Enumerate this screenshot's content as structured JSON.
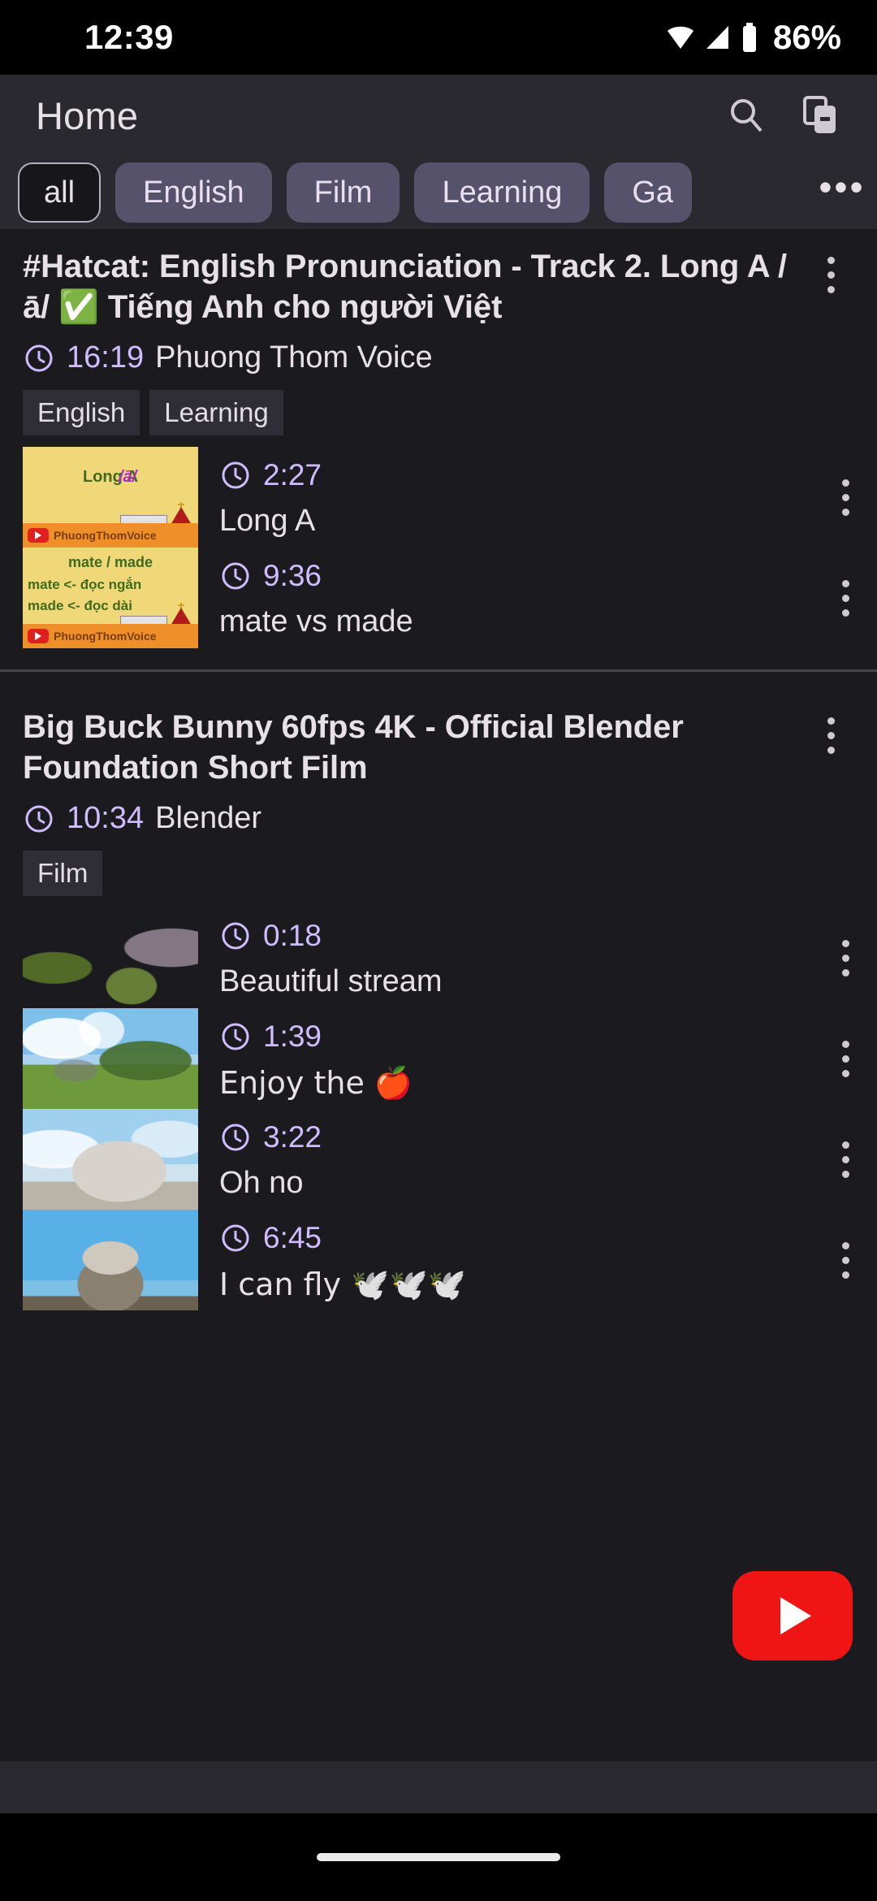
{
  "status_bar": {
    "time": "12:39",
    "battery_percent": "86%",
    "icons": [
      "wifi-icon",
      "signal-icon",
      "battery-icon"
    ]
  },
  "app_bar": {
    "title": "Home",
    "actions": [
      {
        "name": "search-icon",
        "label": "Search"
      },
      {
        "name": "queue-icon",
        "label": "Queue"
      }
    ]
  },
  "filter_chips": {
    "items": [
      {
        "label": "all",
        "selected": true
      },
      {
        "label": "English",
        "selected": false
      },
      {
        "label": "Film",
        "selected": false
      },
      {
        "label": "Learning",
        "selected": false
      },
      {
        "label": "Ga",
        "selected": false
      }
    ],
    "overflow_label": "•••"
  },
  "videos": [
    {
      "title": "#Hatcat: English Pronunciation - Track 2. Long A /ā/ ✅ Tiếng Anh cho người Việt",
      "duration": "16:19",
      "channel": "Phuong Thom Voice",
      "tags": [
        "English",
        "Learning"
      ],
      "thumb_kind": "yellow",
      "items": [
        {
          "time": "2:27",
          "label": "Long A",
          "thumb": "long-a",
          "thumb_line1": "Long A",
          "thumb_line2": "/ā/",
          "watermark": "PhuongThomVoice"
        },
        {
          "time": "9:36",
          "label": "mate vs made",
          "thumb": "mate-made",
          "thumb_line1": "mate / made",
          "thumb_line2": "mate <- đọc ngắn",
          "thumb_line3": "made <- đọc dài",
          "watermark": "PhuongThomVoice"
        }
      ]
    },
    {
      "title": "Big Buck Bunny 60fps 4K - Official Blender Foundation Short Film",
      "duration": "10:34",
      "channel": "Blender",
      "tags": [
        "Film"
      ],
      "thumb_kind": "photo",
      "items": [
        {
          "time": "0:18",
          "label": "Beautiful stream",
          "thumb": "grass-stream"
        },
        {
          "time": "1:39",
          "label": "Enjoy the 🍎",
          "thumb": "sky-meadow"
        },
        {
          "time": "3:22",
          "label": "Oh no",
          "thumb": "bunny-face"
        },
        {
          "time": "6:45",
          "label": "I can fly 🕊️🕊️🕊️",
          "thumb": "bunny-fly"
        }
      ]
    }
  ],
  "fab": {
    "name": "youtube-fab",
    "label": "Open YouTube"
  },
  "colors": {
    "accent": "#cfbcff",
    "surface": "#2b2930",
    "background": "#1b1b1f",
    "chip": "#56526b",
    "brand_red": "#f01515",
    "thumb_yellow": "#f0d879",
    "thumb_orange": "#ee8f2a",
    "thumb_green_text": "#3f6b1e",
    "thumb_purple_text": "#b52bc9"
  }
}
